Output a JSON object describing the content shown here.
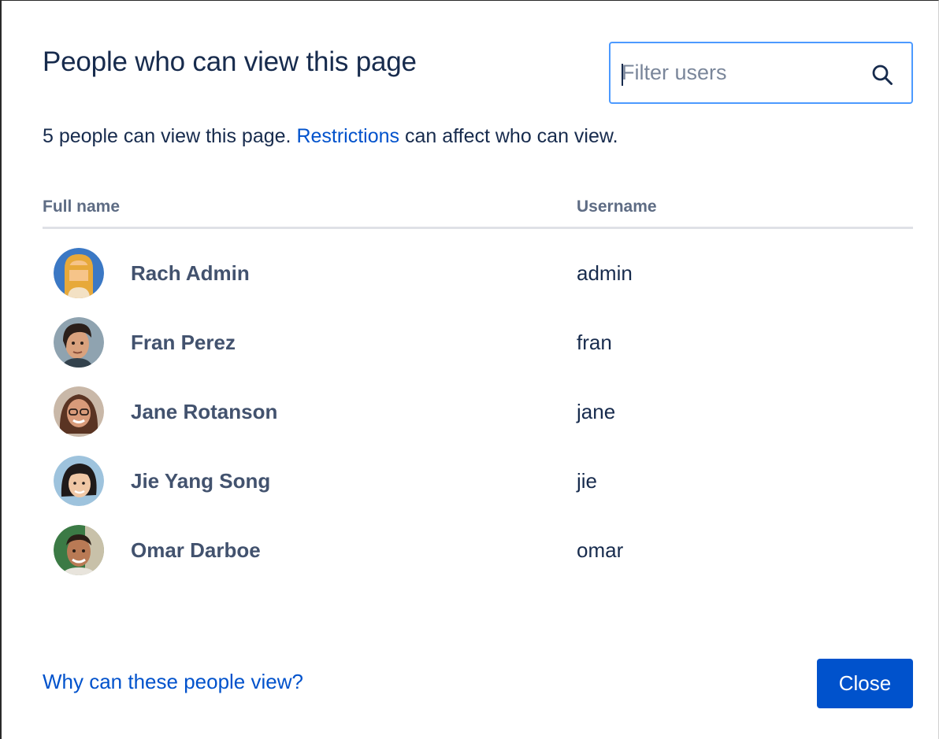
{
  "dialog": {
    "title": "People who can view this page",
    "filter": {
      "placeholder": "Filter users",
      "value": ""
    },
    "summary": {
      "prefix": "5 people can view this page. ",
      "link": "Restrictions",
      "suffix": " can affect who can view."
    },
    "table": {
      "headers": {
        "full_name": "Full name",
        "username": "Username"
      },
      "rows": [
        {
          "full_name": "Rach Admin",
          "username": "admin",
          "avatar": "avatar-rach-admin"
        },
        {
          "full_name": "Fran Perez",
          "username": "fran",
          "avatar": "avatar-fran-perez"
        },
        {
          "full_name": "Jane Rotanson",
          "username": "jane",
          "avatar": "avatar-jane-rotanson"
        },
        {
          "full_name": "Jie Yang Song",
          "username": "jie",
          "avatar": "avatar-jie-yang-song"
        },
        {
          "full_name": "Omar Darboe",
          "username": "omar",
          "avatar": "avatar-omar-darboe"
        }
      ]
    },
    "footer": {
      "why_link": "Why can these people view?",
      "close_label": "Close"
    }
  },
  "colors": {
    "primary": "#0052cc",
    "focus_border": "#4c9aff",
    "text": "#172b4d",
    "subtle_text": "#5e6c84"
  },
  "icons": {
    "search": "search-icon"
  }
}
